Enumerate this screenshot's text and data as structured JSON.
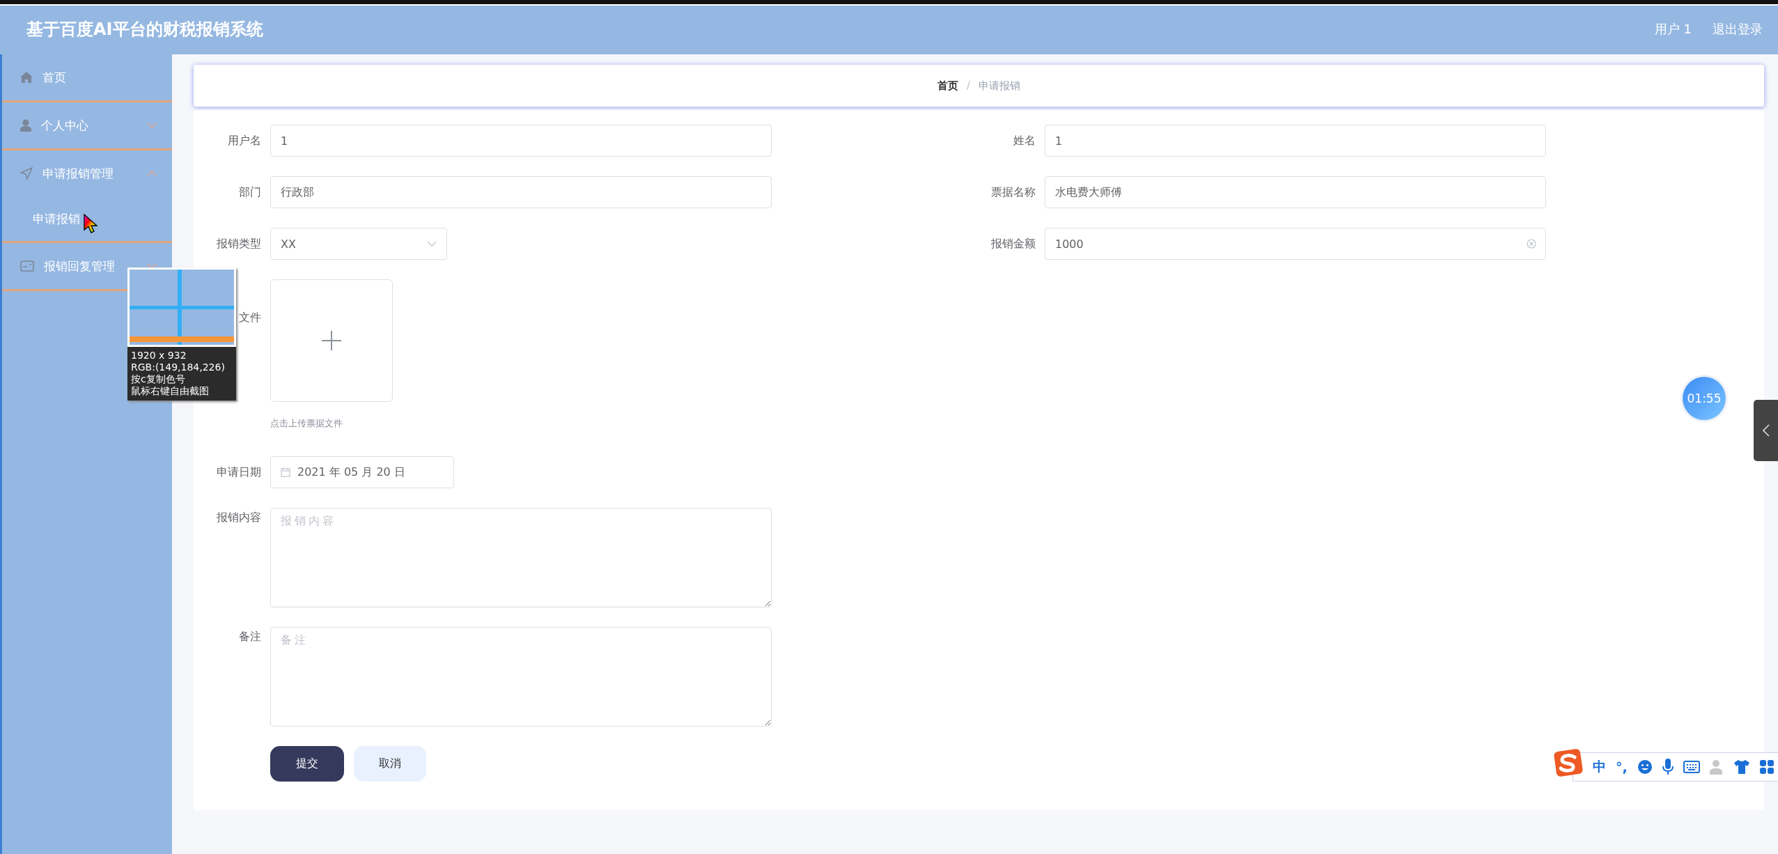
{
  "header": {
    "title": "基于百度AI平台的财税报销系统",
    "user": "用户 1",
    "logout": "退出登录"
  },
  "sidebar": {
    "items": [
      {
        "kind": "link",
        "label": "首页"
      },
      {
        "kind": "submenu",
        "label": "个人中心",
        "expanded": false
      },
      {
        "kind": "submenu",
        "label": "申请报销管理",
        "expanded": true,
        "children": [
          {
            "label": "申请报销"
          }
        ]
      },
      {
        "kind": "submenu",
        "label": "报销回复管理",
        "expanded": false
      }
    ]
  },
  "breadcrumb": {
    "items": [
      "首页",
      "申请报销"
    ],
    "separator": "/"
  },
  "form": {
    "rows": [
      [
        {
          "kind": "text",
          "label": "用户名",
          "value": "1"
        },
        {
          "kind": "text",
          "label": "姓名",
          "value": "1"
        }
      ],
      [
        {
          "kind": "text",
          "label": "部门",
          "value": "行政部"
        },
        {
          "kind": "text",
          "label": "票据名称",
          "value": "水电费大师傅"
        }
      ],
      [
        {
          "kind": "select",
          "label": "报销类型",
          "value": "XX"
        },
        {
          "kind": "text",
          "label": "报销金额",
          "value": "1000",
          "clearable": true
        }
      ],
      [
        {
          "kind": "upload",
          "label": "文件",
          "hint": "点击上传票据文件"
        }
      ],
      [
        {
          "kind": "date",
          "label": "申请日期",
          "value": "2021 年 05 月 20 日"
        }
      ],
      [
        {
          "kind": "textarea",
          "label": "报销内容",
          "placeholder": "报销内容"
        }
      ],
      [
        {
          "kind": "textarea",
          "label": "备注",
          "placeholder": "备注"
        }
      ]
    ],
    "buttons": [
      {
        "kind": "primary",
        "label": "提交"
      },
      {
        "kind": "secondary",
        "label": "取消"
      }
    ]
  },
  "color_picker": {
    "lines": [
      "1920 x 932",
      "RGB:(149,184,226)",
      "按c复制色号",
      "鼠标右键自由截图"
    ]
  },
  "timer": "01:55",
  "ime": {
    "mode": "中",
    "punct": "°,"
  }
}
